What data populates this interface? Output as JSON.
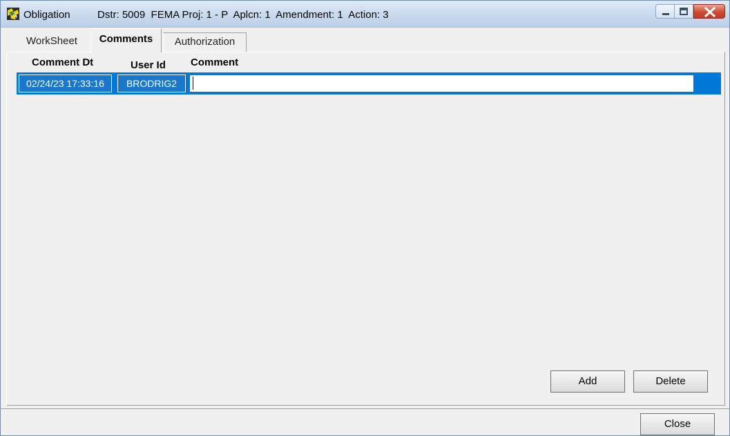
{
  "window": {
    "title": "Obligation",
    "info": "Dstr: 5009  FEMA Proj: 1 - P  Aplcn: 1  Amendment: 1  Action: 3",
    "icon": "app-icon"
  },
  "tabs": [
    {
      "label": "WorkSheet",
      "active": false
    },
    {
      "label": "Comments",
      "active": true
    },
    {
      "label": "Authorization",
      "active": false
    }
  ],
  "grid": {
    "columns": [
      "Comment Dt",
      "User Id",
      "Comment"
    ],
    "rows": [
      {
        "comment_dt": "02/24/23 17:33:16",
        "user_id": "BRODRIG2",
        "comment": ""
      }
    ]
  },
  "buttons": {
    "add": "Add",
    "delete": "Delete",
    "close": "Close"
  },
  "colors": {
    "selection": "#0078d7",
    "close_button": "#c94431"
  }
}
